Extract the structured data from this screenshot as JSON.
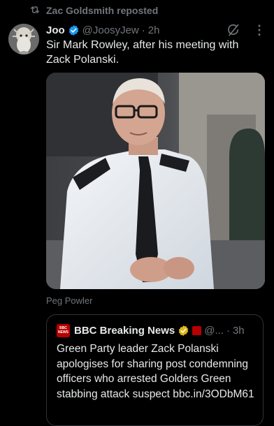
{
  "repost": {
    "text": "Zac Goldsmith reposted",
    "icon": "repost-icon"
  },
  "author": {
    "name": "Joo",
    "handle": "@JoosyJew",
    "separator": "·",
    "time": "2h",
    "verified_color": "#1d9bf0"
  },
  "tweet": {
    "text": "Sir Mark Rowley, after his meeting with Zack Polanski."
  },
  "media": {
    "caption": "Peg Powler"
  },
  "quote": {
    "name": "BBC Breaking News",
    "handle": "@...",
    "separator": "·",
    "time": "3h",
    "text": "Green Party leader Zack Polanski apologises for sharing post condemning officers who arrested Golders Green stabbing attack suspect bbc.in/3ODbM61",
    "verified_color": "#e2b719",
    "logo_lines": [
      "BBC",
      "NEWS"
    ]
  },
  "colors": {
    "background": "#000000",
    "text": "#e7e9ea",
    "muted": "#71767b",
    "border": "#2f3336"
  }
}
